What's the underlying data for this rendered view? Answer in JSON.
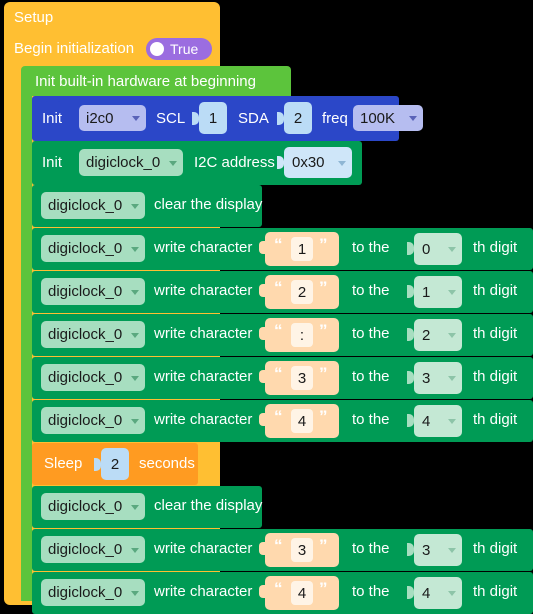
{
  "app": {
    "kind": "blockly-visual-programming",
    "background": "#000000"
  },
  "colors": {
    "setup_block": "#FFBF32",
    "hardware_block": "#5CC43C",
    "i2c_block": "#2B47C8",
    "device_block": "#009B55",
    "sleep_block": "#FF9B21",
    "text_block": "#FFD9AE",
    "toggle_on": "#9B6DE0"
  },
  "setup": {
    "title": "Setup",
    "begin_label": "Begin initialization",
    "begin_toggle_value": "True"
  },
  "hardware": {
    "label": "Init built-in hardware at beginning"
  },
  "i2c_init": {
    "init_label": "Init",
    "bus": "i2c0",
    "scl_label": "SCL",
    "scl_pin": "1",
    "sda_label": "SDA",
    "sda_pin": "2",
    "freq_label": "freq",
    "freq_value": "100K"
  },
  "device_init": {
    "init_label": "Init",
    "device": "digiclock_0",
    "address_label": "I2C address",
    "address_value": "0x30"
  },
  "statements": [
    {
      "kind": "clear",
      "device": "digiclock_0",
      "action": "clear the display"
    },
    {
      "kind": "write",
      "device": "digiclock_0",
      "action": "write character",
      "char": "1",
      "to_label": "to the",
      "digit": "0",
      "digit_suffix": "th digit"
    },
    {
      "kind": "write",
      "device": "digiclock_0",
      "action": "write character",
      "char": "2",
      "to_label": "to the",
      "digit": "1",
      "digit_suffix": "th digit"
    },
    {
      "kind": "write",
      "device": "digiclock_0",
      "action": "write character",
      "char": ":",
      "to_label": "to the",
      "digit": "2",
      "digit_suffix": "th digit"
    },
    {
      "kind": "write",
      "device": "digiclock_0",
      "action": "write character",
      "char": "3",
      "to_label": "to the",
      "digit": "3",
      "digit_suffix": "th digit"
    },
    {
      "kind": "write",
      "device": "digiclock_0",
      "action": "write character",
      "char": "4",
      "to_label": "to the",
      "digit": "4",
      "digit_suffix": "th digit"
    },
    {
      "kind": "sleep",
      "label": "Sleep",
      "value": "2",
      "unit": "seconds"
    },
    {
      "kind": "clear",
      "device": "digiclock_0",
      "action": "clear the display"
    },
    {
      "kind": "write",
      "device": "digiclock_0",
      "action": "write character",
      "char": "3",
      "to_label": "to the",
      "digit": "3",
      "digit_suffix": "th digit"
    },
    {
      "kind": "write",
      "device": "digiclock_0",
      "action": "write character",
      "char": "4",
      "to_label": "to the",
      "digit": "4",
      "digit_suffix": "th digit"
    }
  ]
}
